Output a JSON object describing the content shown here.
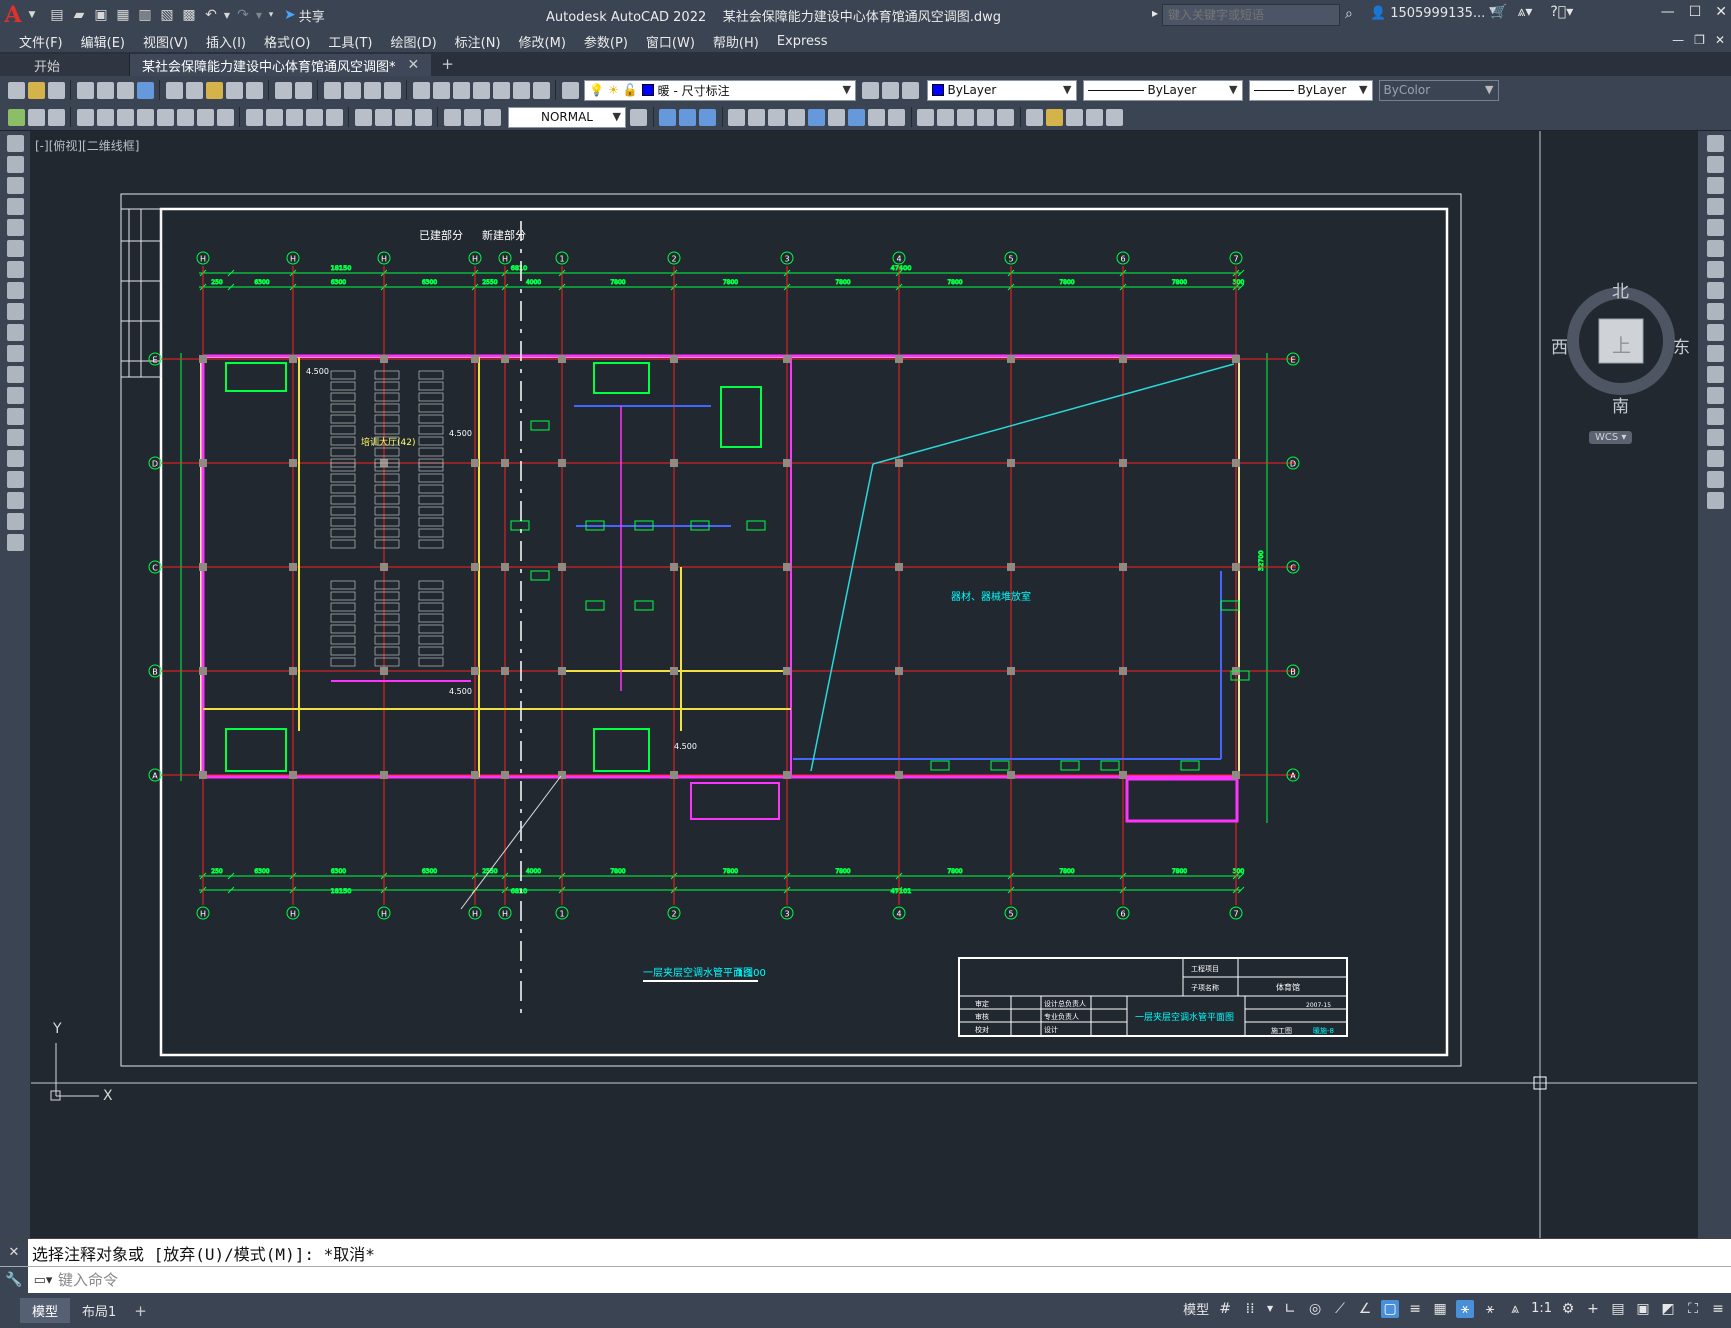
{
  "titlebar": {
    "app_name": "Autodesk AutoCAD 2022",
    "file_name": "某社会保障能力建设中心体育馆通风空调图.dwg",
    "share_label": "共享",
    "search_placeholder": "键入关键字或短语",
    "user_name": "1505999135..."
  },
  "menu": [
    "文件(F)",
    "编辑(E)",
    "视图(V)",
    "插入(I)",
    "格式(O)",
    "工具(T)",
    "绘图(D)",
    "标注(N)",
    "修改(M)",
    "参数(P)",
    "窗口(W)",
    "帮助(H)",
    "Express"
  ],
  "tabs": [
    {
      "label": "开始",
      "active": false
    },
    {
      "label": "某社会保障能力建设中心体育馆通风空调图*",
      "active": true
    }
  ],
  "properties": {
    "layer": "暖 - 尺寸标注",
    "color": "ByLayer",
    "linetype": "ByLayer",
    "lineweight": "ByLayer",
    "plotstyle": "ByColor",
    "dimstyle": "NORMAL",
    "color_swatch": "#0000ff"
  },
  "viewport": {
    "label": "[-][俯视][二维线框]"
  },
  "viewcube": {
    "north": "北",
    "south": "南",
    "east": "东",
    "west": "西",
    "top": "上",
    "wcs": "WCS"
  },
  "drawing": {
    "heading_left": "已建部分",
    "heading_right": "新建部分",
    "plan_title": "一层夹层空调水管平面图",
    "scale": "1:100",
    "room_main": "器材、器械堆放室",
    "room_hall": "培训大厅(42)",
    "elev_1": "4.500",
    "elev_2": "4.500",
    "elev_3": "4.500",
    "elev_4": "4.500",
    "axes_top": [
      "H",
      "H",
      "H",
      "H",
      "H",
      "1",
      "2",
      "3",
      "4",
      "5",
      "6",
      "7"
    ],
    "axes_side": [
      "E",
      "D",
      "C",
      "B",
      "A"
    ],
    "dim_top_total_left": "18150",
    "dim_top_total_mid": "6810",
    "dim_top_total_right": "47400",
    "dim_bottom_total_right": "47101",
    "dims_segments": [
      "250",
      "6300",
      "6300",
      "6300",
      "2550",
      "4000",
      "7800",
      "7800",
      "7800",
      "7800",
      "7800",
      "7800",
      "300"
    ],
    "dim_side_total": "32700",
    "title_block": {
      "project_label": "工程项目",
      "item_label": "子项名称",
      "item_value": "体育馆",
      "drawing_name": "一层夹层空调水管平面图",
      "stage": "施工图",
      "drawing_no": "暖施-8",
      "date": "2007-15",
      "roles": [
        "审定",
        "审核",
        "校对"
      ],
      "roles2": [
        "设计总负责人",
        "专业负责人",
        "设计"
      ]
    }
  },
  "command": {
    "history": "选择注释对象或 [放弃(U)/模式(M)]: *取消*",
    "placeholder": "键入命令"
  },
  "layout_tabs": [
    "模型",
    "布局1"
  ],
  "status": {
    "model": "模型",
    "scale": "1:1"
  }
}
